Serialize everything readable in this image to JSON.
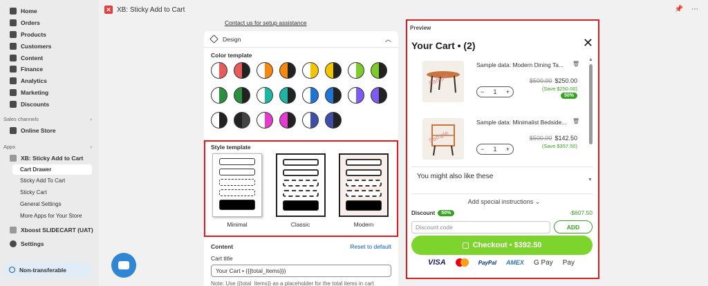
{
  "sidebar": {
    "main_nav": [
      {
        "label": "Home",
        "icon": "home-icon"
      },
      {
        "label": "Orders",
        "icon": "orders-icon"
      },
      {
        "label": "Products",
        "icon": "tag-icon"
      },
      {
        "label": "Customers",
        "icon": "person-icon"
      },
      {
        "label": "Content",
        "icon": "content-icon"
      },
      {
        "label": "Finance",
        "icon": "bank-icon"
      },
      {
        "label": "Analytics",
        "icon": "chart-icon"
      },
      {
        "label": "Marketing",
        "icon": "target-icon"
      },
      {
        "label": "Discounts",
        "icon": "discount-icon"
      }
    ],
    "sales_channels_label": "Sales channels",
    "online_store": "Online Store",
    "apps_label": "Apps",
    "app_name": "XB: Sticky Add to Cart",
    "app_subitems": [
      "Cart Drawer",
      "Sticky Add To Cart",
      "Sticky Cart",
      "General Settings",
      "More Apps for Your Store"
    ],
    "other_app": "Xboost SLIDECART (UAT)",
    "settings": "Settings",
    "non_transferable": "Non-transferable"
  },
  "topbar": {
    "title": "XB: Sticky Add to Cart"
  },
  "settings": {
    "contact_link": "Contact us for setup assistance",
    "design_title": "Design",
    "color_template_label": "Color template",
    "color_swatches": [
      [
        "#ffffff",
        "#e85b5b"
      ],
      [
        "#e85b5b",
        "#222222"
      ],
      [
        "#ffffff",
        "#f6870f"
      ],
      [
        "#f6870f",
        "#222222"
      ],
      [
        "#ffffff",
        "#f5c400"
      ],
      [
        "#f5c400",
        "#222222"
      ],
      [
        "#ffffff",
        "#7ecb2b"
      ],
      [
        "#7ecb2b",
        "#222222"
      ],
      [
        "#ffffff",
        "#2c8f3f"
      ],
      [
        "#2c8f3f",
        "#222222"
      ],
      [
        "#ffffff",
        "#1fb5a5"
      ],
      [
        "#1fb5a5",
        "#222222"
      ],
      [
        "#ffffff",
        "#1f74d4"
      ],
      [
        "#1f74d4",
        "#222222"
      ],
      [
        "#ffffff",
        "#7d5cf0"
      ],
      [
        "#7d5cf0",
        "#222222"
      ],
      [
        "#ffffff",
        "#222222"
      ],
      [
        "#222222",
        "#444444"
      ],
      [
        "#ffffff",
        "#e63bcf"
      ],
      [
        "#e63bcf",
        "#222222"
      ],
      [
        "#ffffff",
        "#3f4fa8"
      ],
      [
        "#3f4fa8",
        "#222222"
      ]
    ],
    "style_template_label": "Style template",
    "templates": [
      "Minimal",
      "Classic",
      "Modern"
    ],
    "content_label": "Content",
    "reset_label": "Reset to default",
    "cart_title_label": "Cart title",
    "cart_title_value": "Your Cart • ({{total_items}})",
    "note": "Note: Use {{total_items}} as a placeholder for the total items in cart"
  },
  "preview": {
    "label": "Preview",
    "cart_title": "Your Cart • (2)",
    "items": [
      {
        "prefix": "Sample data:",
        "name": "Modern Dining Ta...",
        "qty": "1",
        "original_price": "$500.00",
        "price": "$250.00",
        "save": "(Save $250.00)",
        "badge": "50%",
        "watermark": "Sample"
      },
      {
        "prefix": "Sample data:",
        "name": "Minimalist Bedside...",
        "qty": "1",
        "original_price": "$500.00",
        "price": "$142.50",
        "save": "(Save $357.50)",
        "badge": "",
        "watermark": "Sample"
      }
    ],
    "also_like": "You might also like these",
    "special_instructions": "Add special instructions",
    "discount_label": "Discount",
    "discount_badge": "50%",
    "discount_amount": "-$607.50",
    "discount_placeholder": "Discount code",
    "add_button": "ADD",
    "checkout_label": "Checkout • $392.50",
    "payments": [
      "VISA",
      "PayPal",
      "AMEX",
      "G Pay",
      " Pay"
    ]
  },
  "colors": {
    "accent_green": "#7dd42c",
    "highlight_red": "#e0191a"
  }
}
